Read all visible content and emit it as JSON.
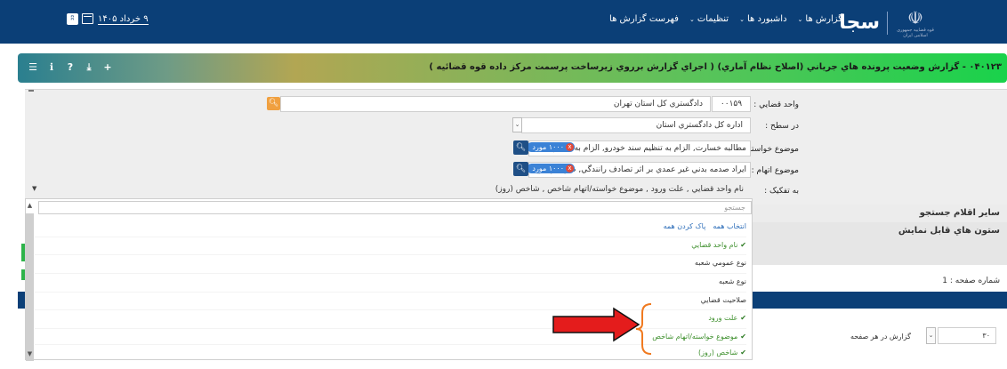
{
  "nav": {
    "brand": "سجا",
    "emblem_glyph": "☫",
    "emblem_caption": "قوه قضاییه جمهوری اسلامی ایران",
    "menu": [
      {
        "label": "گزارش ها",
        "chevron": "⌄"
      },
      {
        "label": "داشبورد ها",
        "chevron": "⌄"
      },
      {
        "label": "تنظیمات",
        "chevron": "⌄"
      },
      {
        "label": "فهرست گزارش ها",
        "chevron": ""
      }
    ],
    "date": "۹ خرداد ۱۴۰۵",
    "icons": [
      "calendar-icon",
      "rss-icon"
    ]
  },
  "report": {
    "title": "۰۴۰۱۲۳ - گزارش وضعیت پرونده هاي جرياني (اصلاح نظام آماري) ( اجراي گزارش برروي زيرساخت پرسمت مركز داده قوه قضائيه )",
    "toolbar": [
      {
        "name": "menu-icon",
        "glyph": "☰"
      },
      {
        "name": "info-icon",
        "glyph": "ℹ"
      },
      {
        "name": "help-icon",
        "glyph": "?"
      },
      {
        "name": "download-icon",
        "glyph": "⤓"
      },
      {
        "name": "add-icon",
        "glyph": "+"
      }
    ]
  },
  "form": {
    "judicial_unit": {
      "label": "واحد قضايي :",
      "code": "۰۰۱۵۹",
      "name": "دادگستري كل استان تهران"
    },
    "level": {
      "label": "در سطح :",
      "value": "اداره كل دادگستري استان"
    },
    "claim_subject": {
      "label": "موضوع خواسته :",
      "text": "مطالبه خسارت, الزام به تنظيم سند خودرو, الزام به تنظيم سند",
      "badge": "۱۰۰۰ مورد",
      "remove": "x"
    },
    "charge_subject": {
      "label": "موضوع اتهام :",
      "text": "ايراد صدمه بدني غير عمدي بر اثر تصادف رانندگي, ضرب و جرح",
      "badge": "۱۰۰۰ مورد",
      "remove": "x"
    },
    "breakdown": {
      "label": "به تفكيک :",
      "value": "نام واحد قضايي , علت ورود , موضوع خواسته/اتهام شاخص , شاخص (روز)"
    }
  },
  "sections": {
    "other_search": "ساير اقلام جستجو",
    "visible_columns": "ستون هاي قابل نمايش"
  },
  "dropdown": {
    "search_placeholder": "جستجو",
    "select_all": "انتخاب همه",
    "clear_all": "پاک كردن همه",
    "items": [
      {
        "label": "نام واحد قضايي",
        "checked": true
      },
      {
        "label": "نوع عمومي شعبه",
        "checked": false
      },
      {
        "label": "نوع شعبه",
        "checked": false
      },
      {
        "label": "صلاحيت قضايي",
        "checked": false
      },
      {
        "label": "علت ورود",
        "checked": true
      },
      {
        "label": "موضوع خواسته/اتهام شاخص",
        "checked": true
      },
      {
        "label": "شاخص (روز)",
        "checked": true
      }
    ],
    "check_glyph": "✔"
  },
  "pagination": {
    "page_label": "شماره صفحه :",
    "page_value": "1",
    "per_page_label": "گزارش در هر صفحه",
    "per_page_value": "۳۰"
  },
  "colors": {
    "navbar": "#0b3f77",
    "search_button": "#f0a040",
    "tag_badge": "#3b82d6",
    "annotation_arrow": "#e41c1c",
    "annotation_brace": "#f07a20"
  }
}
